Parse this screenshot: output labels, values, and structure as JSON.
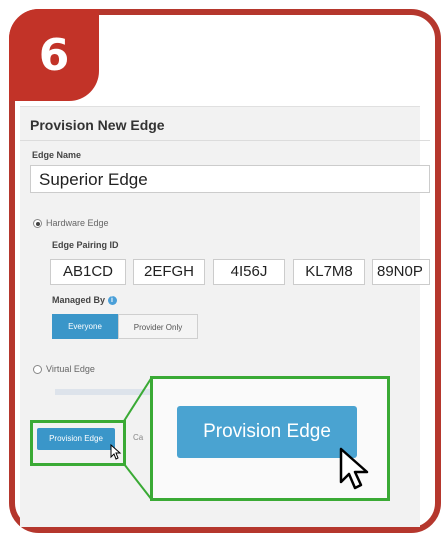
{
  "step": {
    "number": "6"
  },
  "form": {
    "title": "Provision New Edge",
    "edge_name_label": "Edge Name",
    "edge_name_value": "Superior Edge",
    "hardware_edge_label": "Hardware Edge",
    "pairing_id_label": "Edge Pairing ID",
    "pairing_ids": [
      "AB1CD",
      "2EFGH",
      "4I56J",
      "KL7M8",
      "89N0P"
    ],
    "managed_by_label": "Managed By",
    "managed_by_options": [
      "Everyone",
      "Provider Only"
    ],
    "managed_by_selected": "Everyone",
    "virtual_edge_label": "Virtual Edge",
    "provision_button_label": "Provision Edge",
    "cancel_label": "Ca"
  },
  "zoom": {
    "provision_button_label": "Provision Edge"
  },
  "colors": {
    "frame": "#b5372d",
    "badge": "#c23328",
    "accent_blue": "#3a96c9",
    "highlight_green": "#3aaa35"
  }
}
